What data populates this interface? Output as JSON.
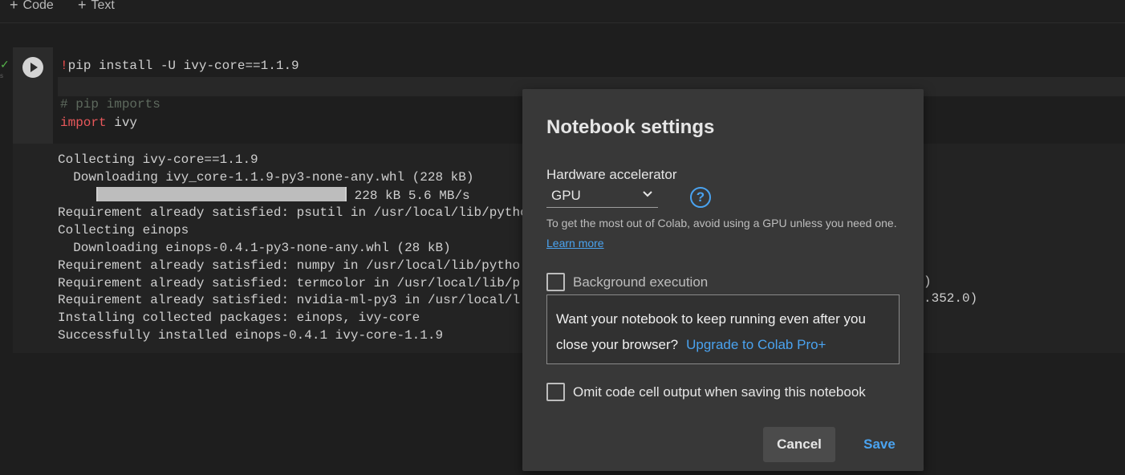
{
  "toolbar": {
    "code_label": "Code",
    "text_label": "Text"
  },
  "cell": {
    "exec_mark": "✓",
    "exec_time": "s",
    "code_line1_bang": "!",
    "code_line1": "pip install -U ivy-core==1.1.9",
    "comment": "# pip imports",
    "import_kw": "import",
    "import_mod": " ivy",
    "output_lines": [
      "Collecting ivy-core==1.1.9",
      "  Downloading ivy_core-1.1.9-py3-none-any.whl (228 kB)",
      "Requirement already satisfied: psutil in /usr/local/lib/pytho",
      "Collecting einops",
      "  Downloading einops-0.4.1-py3-none-any.whl (28 kB)",
      "Requirement already satisfied: numpy in /usr/local/lib/pytho",
      "Requirement already satisfied: termcolor in /usr/local/lib/p",
      "Requirement already satisfied: nvidia-ml-py3 in /usr/local/l",
      "Installing collected packages: einops, ivy-core",
      "Successfully installed einops-0.4.1 ivy-core-1.1.9"
    ],
    "progress_text": " 228 kB 5.6 MB/s",
    "progress_fraction": 1.0,
    "trailing_right_1": ")",
    "trailing_right_2": ".352.0)"
  },
  "dialog": {
    "title": "Notebook settings",
    "hw_label": "Hardware accelerator",
    "hw_value": "GPU",
    "hint_text": "To get the most out of Colab, avoid using a GPU unless you need one. ",
    "learn_more": "Learn more",
    "bg_exec_label": "Background execution",
    "promo_text": "Want your notebook to keep running even after you close your browser?",
    "promo_link": "Upgrade to Colab Pro+",
    "omit_label": "Omit code cell output when saving this notebook",
    "cancel_label": "Cancel",
    "save_label": "Save"
  },
  "colors": {
    "accent": "#4aa3f0",
    "keyword": "#e8585b"
  },
  "icons": {
    "run": "play-icon",
    "help": "help-icon",
    "dropdown": "chevron-down-icon"
  }
}
